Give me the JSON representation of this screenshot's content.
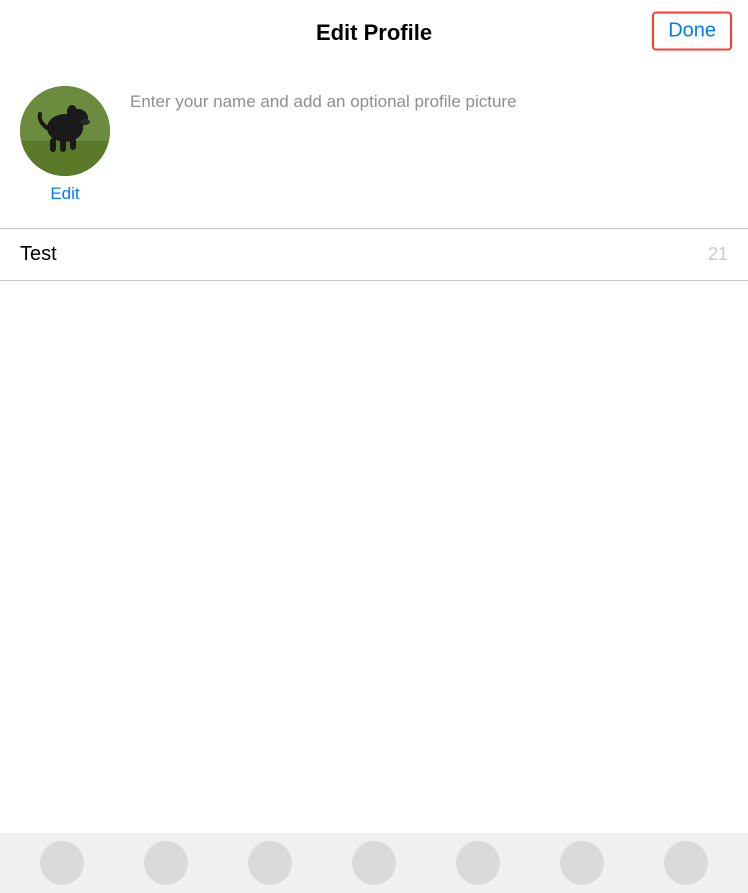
{
  "header": {
    "title": "Edit Profile",
    "done_button_label": "Done"
  },
  "profile": {
    "description": "Enter your name and add an optional profile picture",
    "edit_label": "Edit",
    "name_value": "Test",
    "char_count": "21"
  },
  "colors": {
    "blue": "#007AFF",
    "red_border": "#FF3B30",
    "gray_text": "#8E8E93",
    "divider": "#C6C6C8",
    "char_count": "#C7C7CC"
  },
  "bottom_bar": {
    "icon_count": 7
  }
}
